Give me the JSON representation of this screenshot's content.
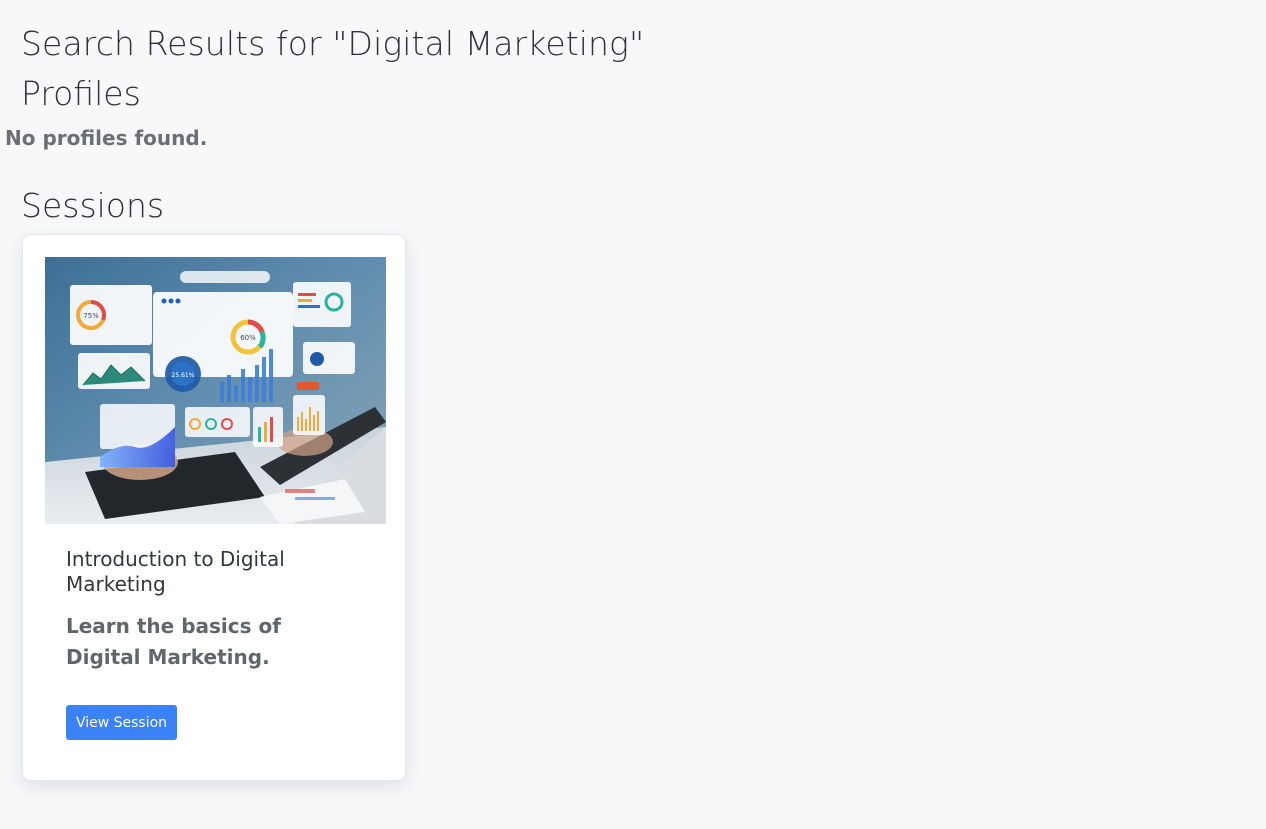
{
  "page": {
    "search_title": "Search Results for \"Digital Marketing\"",
    "profiles_heading": "Profiles",
    "no_profiles_text": "No profiles found.",
    "sessions_heading": "Sessions"
  },
  "sessions": [
    {
      "title": "Introduction to Digital Marketing",
      "description": "Learn the basics of Digital Marketing.",
      "button_label": "View Session",
      "image_stats": [
        "75%",
        "60%",
        "25.61%"
      ]
    }
  ],
  "colors": {
    "background": "#f7f8fa",
    "button": "#3b82f6"
  }
}
